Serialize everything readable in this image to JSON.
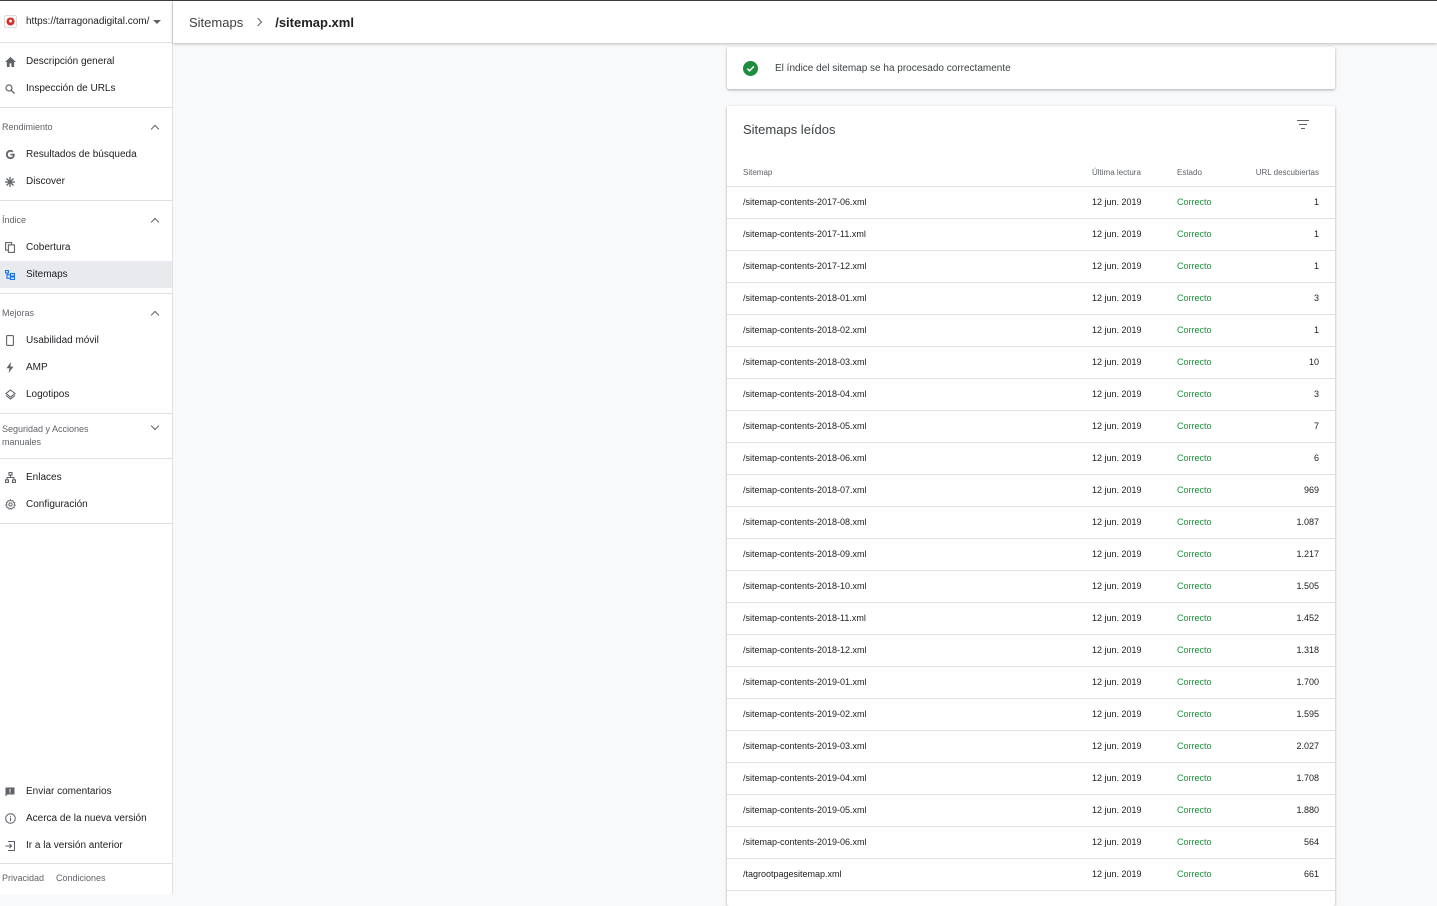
{
  "property": {
    "url": "https://tarragonadigital.com/"
  },
  "nav": {
    "top": [
      {
        "label": "Descripción general",
        "icon": "home-icon"
      },
      {
        "label": "Inspección de URLs",
        "icon": "search-icon"
      }
    ],
    "sections": [
      {
        "title": "Rendimiento",
        "expanded": true,
        "items": [
          {
            "label": "Resultados de búsqueda",
            "icon": "google-icon"
          },
          {
            "label": "Discover",
            "icon": "asterisk-icon"
          }
        ]
      },
      {
        "title": "Índice",
        "expanded": true,
        "items": [
          {
            "label": "Cobertura",
            "icon": "copy-icon"
          },
          {
            "label": "Sitemaps",
            "icon": "sitemap-icon",
            "active": true
          }
        ]
      },
      {
        "title": "Mejoras",
        "expanded": true,
        "items": [
          {
            "label": "Usabilidad móvil",
            "icon": "phone-icon"
          },
          {
            "label": "AMP",
            "icon": "bolt-icon"
          },
          {
            "label": "Logotipos",
            "icon": "layers-icon"
          }
        ]
      },
      {
        "title": "Seguridad y Acciones manuales",
        "expanded": false,
        "items": []
      }
    ],
    "other": [
      {
        "label": "Enlaces",
        "icon": "links-icon"
      },
      {
        "label": "Configuración",
        "icon": "gear-icon"
      }
    ],
    "bottom": [
      {
        "label": "Enviar comentarios",
        "icon": "feedback-icon"
      },
      {
        "label": "Acerca de la nueva versión",
        "icon": "info-icon"
      },
      {
        "label": "Ir a la versión anterior",
        "icon": "exit-icon"
      }
    ],
    "footer": {
      "privacy": "Privacidad",
      "terms": "Condiciones"
    }
  },
  "header": {
    "crumb_parent": "Sitemaps",
    "crumb_current": "/sitemap.xml"
  },
  "status": {
    "message": "El índice del sitemap se ha procesado correctamente"
  },
  "table": {
    "title": "Sitemaps leídos",
    "headers": {
      "sitemap": "Sitemap",
      "date": "Última lectura",
      "state": "Estado",
      "urls": "URL descubiertas"
    },
    "rows": [
      {
        "sitemap": "/sitemap-contents-2017-06.xml",
        "date": "12 jun. 2019",
        "state": "Correcto",
        "urls": "1"
      },
      {
        "sitemap": "/sitemap-contents-2017-11.xml",
        "date": "12 jun. 2019",
        "state": "Correcto",
        "urls": "1"
      },
      {
        "sitemap": "/sitemap-contents-2017-12.xml",
        "date": "12 jun. 2019",
        "state": "Correcto",
        "urls": "1"
      },
      {
        "sitemap": "/sitemap-contents-2018-01.xml",
        "date": "12 jun. 2019",
        "state": "Correcto",
        "urls": "3"
      },
      {
        "sitemap": "/sitemap-contents-2018-02.xml",
        "date": "12 jun. 2019",
        "state": "Correcto",
        "urls": "1"
      },
      {
        "sitemap": "/sitemap-contents-2018-03.xml",
        "date": "12 jun. 2019",
        "state": "Correcto",
        "urls": "10"
      },
      {
        "sitemap": "/sitemap-contents-2018-04.xml",
        "date": "12 jun. 2019",
        "state": "Correcto",
        "urls": "3"
      },
      {
        "sitemap": "/sitemap-contents-2018-05.xml",
        "date": "12 jun. 2019",
        "state": "Correcto",
        "urls": "7"
      },
      {
        "sitemap": "/sitemap-contents-2018-06.xml",
        "date": "12 jun. 2019",
        "state": "Correcto",
        "urls": "6"
      },
      {
        "sitemap": "/sitemap-contents-2018-07.xml",
        "date": "12 jun. 2019",
        "state": "Correcto",
        "urls": "969"
      },
      {
        "sitemap": "/sitemap-contents-2018-08.xml",
        "date": "12 jun. 2019",
        "state": "Correcto",
        "urls": "1.087"
      },
      {
        "sitemap": "/sitemap-contents-2018-09.xml",
        "date": "12 jun. 2019",
        "state": "Correcto",
        "urls": "1.217"
      },
      {
        "sitemap": "/sitemap-contents-2018-10.xml",
        "date": "12 jun. 2019",
        "state": "Correcto",
        "urls": "1.505"
      },
      {
        "sitemap": "/sitemap-contents-2018-11.xml",
        "date": "12 jun. 2019",
        "state": "Correcto",
        "urls": "1.452"
      },
      {
        "sitemap": "/sitemap-contents-2018-12.xml",
        "date": "12 jun. 2019",
        "state": "Correcto",
        "urls": "1.318"
      },
      {
        "sitemap": "/sitemap-contents-2019-01.xml",
        "date": "12 jun. 2019",
        "state": "Correcto",
        "urls": "1.700"
      },
      {
        "sitemap": "/sitemap-contents-2019-02.xml",
        "date": "12 jun. 2019",
        "state": "Correcto",
        "urls": "1.595"
      },
      {
        "sitemap": "/sitemap-contents-2019-03.xml",
        "date": "12 jun. 2019",
        "state": "Correcto",
        "urls": "2.027"
      },
      {
        "sitemap": "/sitemap-contents-2019-04.xml",
        "date": "12 jun. 2019",
        "state": "Correcto",
        "urls": "1.708"
      },
      {
        "sitemap": "/sitemap-contents-2019-05.xml",
        "date": "12 jun. 2019",
        "state": "Correcto",
        "urls": "1.880"
      },
      {
        "sitemap": "/sitemap-contents-2019-06.xml",
        "date": "12 jun. 2019",
        "state": "Correcto",
        "urls": "564"
      },
      {
        "sitemap": "/tagrootpagesitemap.xml",
        "date": "12 jun. 2019",
        "state": "Correcto",
        "urls": "661"
      }
    ]
  },
  "colors": {
    "accent_green": "#1e8e3e",
    "text": "#202124",
    "muted": "#5f6368"
  }
}
